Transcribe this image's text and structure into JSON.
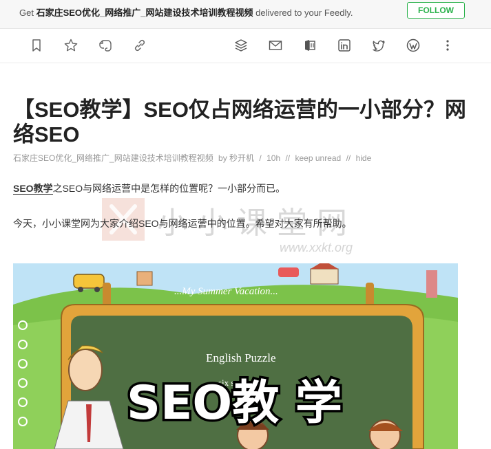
{
  "banner": {
    "prefix": "Get",
    "feed_name": "石家庄SEO优化_网络推广_网站建设技术培训教程视频",
    "suffix": "delivered to your Feedly.",
    "follow_label": "FOLLOW"
  },
  "toolbar": {
    "left_icons": [
      "bookmark-icon",
      "star-icon",
      "evernote-icon",
      "link-icon"
    ],
    "right_icons": [
      "buffer-icon",
      "email-icon",
      "onenote-icon",
      "linkedin-icon",
      "twitter-icon",
      "wordpress-icon",
      "more-icon"
    ]
  },
  "article": {
    "title": "【SEO教学】SEO仅占网络运营的一小部分？网络SEO",
    "meta": {
      "source": "石家庄SEO优化_网络推广_网站建设技术培训教程视频",
      "by": "by 秒开机",
      "sep1": "/",
      "time": "10h",
      "sep2": "//",
      "keep_unread": "keep unread",
      "sep3": "//",
      "hide": "hide"
    },
    "p1_link": "SEO教学",
    "p1_rest": "之SEO与网络运营中是怎样的位置呢？一小部分而已。",
    "p2": "今天，小小课堂网为大家介绍SEO与网络运营中的位置。希望对大家有所帮助。"
  },
  "watermark": {
    "text": "小小课堂网",
    "url": "www.xxkt.org"
  },
  "hero": {
    "banner_text": "...My Summer Vacation...",
    "board_text": "English Puzzle",
    "board_sub": "six  sev",
    "overlay_text": "SEO教 学"
  },
  "colors": {
    "follow_green": "#2bb24c",
    "board_green": "#4f6f43",
    "grass_green": "#7cc24a",
    "frame_orange": "#e2a43b"
  }
}
